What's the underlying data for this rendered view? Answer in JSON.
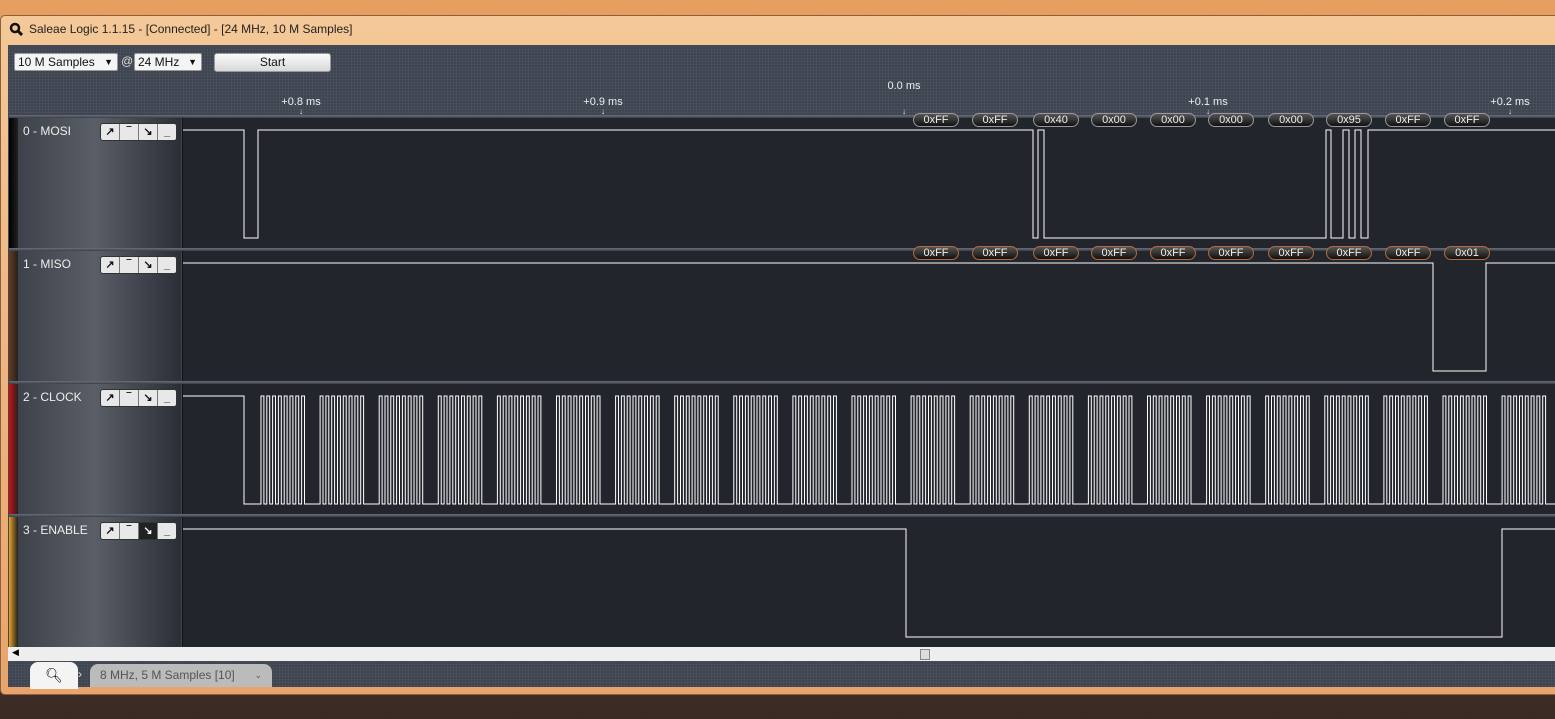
{
  "window": {
    "title": "Saleae Logic 1.1.15 - [Connected] - [24 MHz, 10 M Samples]"
  },
  "toolbar": {
    "samples": "10 M Samples",
    "at": "@",
    "rate": "24 MHz",
    "start": "Start"
  },
  "timeline": [
    "+0.8 ms",
    "+0.9 ms",
    "+0.1 ms",
    "+0.2 ms"
  ],
  "zero_label": "0.0 ms",
  "channels": [
    {
      "name": "0 - MOSI",
      "color": "#000000",
      "trigger": [
        "↗",
        "‾",
        "↘",
        "_"
      ]
    },
    {
      "name": "1 - MISO",
      "color": "#6a3a1a",
      "trigger": [
        "↗",
        "‾",
        "↘",
        "_"
      ]
    },
    {
      "name": "2 - CLOCK",
      "color": "#d01010",
      "trigger": [
        "↗",
        "‾",
        "↘",
        "_"
      ]
    },
    {
      "name": "3 - ENABLE",
      "color": "#e8a020",
      "trigger": [
        "↗",
        "‾",
        "↘",
        "_"
      ]
    }
  ],
  "decoded": {
    "mosi": [
      "0xFF",
      "0xFF",
      "0x40",
      "0x00",
      "0x00",
      "0x00",
      "0x00",
      "0x95",
      "0xFF",
      "0xFF"
    ],
    "miso": [
      "0xFF",
      "0xFF",
      "0xFF",
      "0xFF",
      "0xFF",
      "0xFF",
      "0xFF",
      "0xFF",
      "0xFF",
      "0x01"
    ]
  },
  "tabs": {
    "search_icon": "search-icon",
    "capture_tab": "8 MHz, 5 M Samples [10]"
  }
}
